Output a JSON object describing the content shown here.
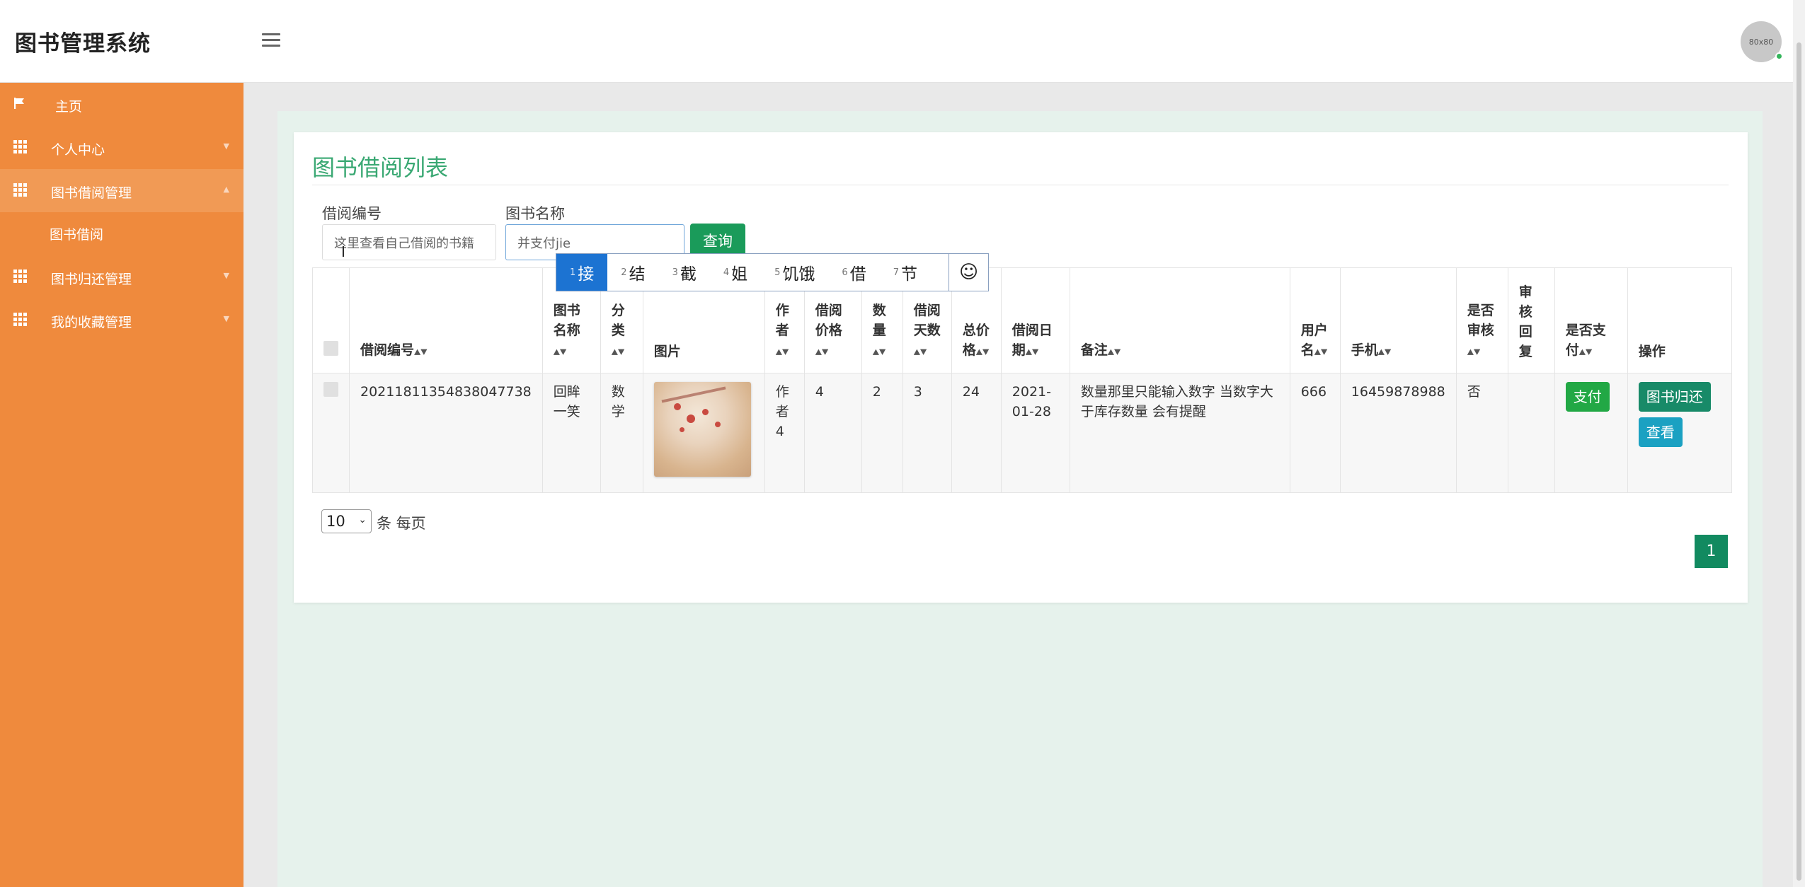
{
  "app": {
    "title": "图书管理系统",
    "avatar_label": "80x80"
  },
  "sidebar": {
    "items": [
      {
        "label": "主页",
        "icon": "flag-icon"
      },
      {
        "label": "个人中心",
        "icon": "grid-icon"
      },
      {
        "label": "图书借阅管理",
        "icon": "grid-icon"
      },
      {
        "label": "图书借阅",
        "icon": ""
      },
      {
        "label": "图书归还管理",
        "icon": "grid-icon"
      },
      {
        "label": "我的收藏管理",
        "icon": "grid-icon"
      }
    ]
  },
  "main": {
    "title": "图书借阅列表",
    "filters": {
      "borrow_no_label": "借阅编号",
      "borrow_no_value": "这里查看自己借阅的书籍",
      "book_name_label": "图书名称",
      "book_name_value": "并支付jie",
      "search_label": "查询"
    },
    "ime": {
      "candidates": [
        {
          "num": "1",
          "text": "接"
        },
        {
          "num": "2",
          "text": "结"
        },
        {
          "num": "3",
          "text": "截"
        },
        {
          "num": "4",
          "text": "姐"
        },
        {
          "num": "5",
          "text": "饥饿"
        },
        {
          "num": "6",
          "text": "借"
        },
        {
          "num": "7",
          "text": "节"
        }
      ],
      "emoji": "☺"
    },
    "table": {
      "headers": [
        "借阅编号",
        "图书名称",
        "分类",
        "图片",
        "作者",
        "借阅价格",
        "数量",
        "借阅天数",
        "总价格",
        "借阅日期",
        "备注",
        "用户名",
        "手机",
        "是否审核",
        "审核回复",
        "是否支付",
        "操作"
      ],
      "row": {
        "borrow_no": "20211811354838047738",
        "book_name": "回眸一笑",
        "category": "数学",
        "author": "作者4",
        "price": "4",
        "quantity": "2",
        "days": "3",
        "total": "24",
        "date": "2021-01-28",
        "remark": "数量那里只能输入数字 当数字大于库存数量 会有提醒",
        "username": "666",
        "phone": "16459878988",
        "audited": "否",
        "audit_reply": "",
        "pay_label": "支付",
        "return_label": "图书归还",
        "view_label": "查看"
      }
    },
    "pager": {
      "page_size": "10",
      "per_page_text": "条 每页",
      "current_page": "1"
    }
  },
  "colors": {
    "sidebar": "#ef8a3d",
    "accent": "#3aa873",
    "search_button": "#1a9b5a",
    "page_button": "#128a60"
  }
}
